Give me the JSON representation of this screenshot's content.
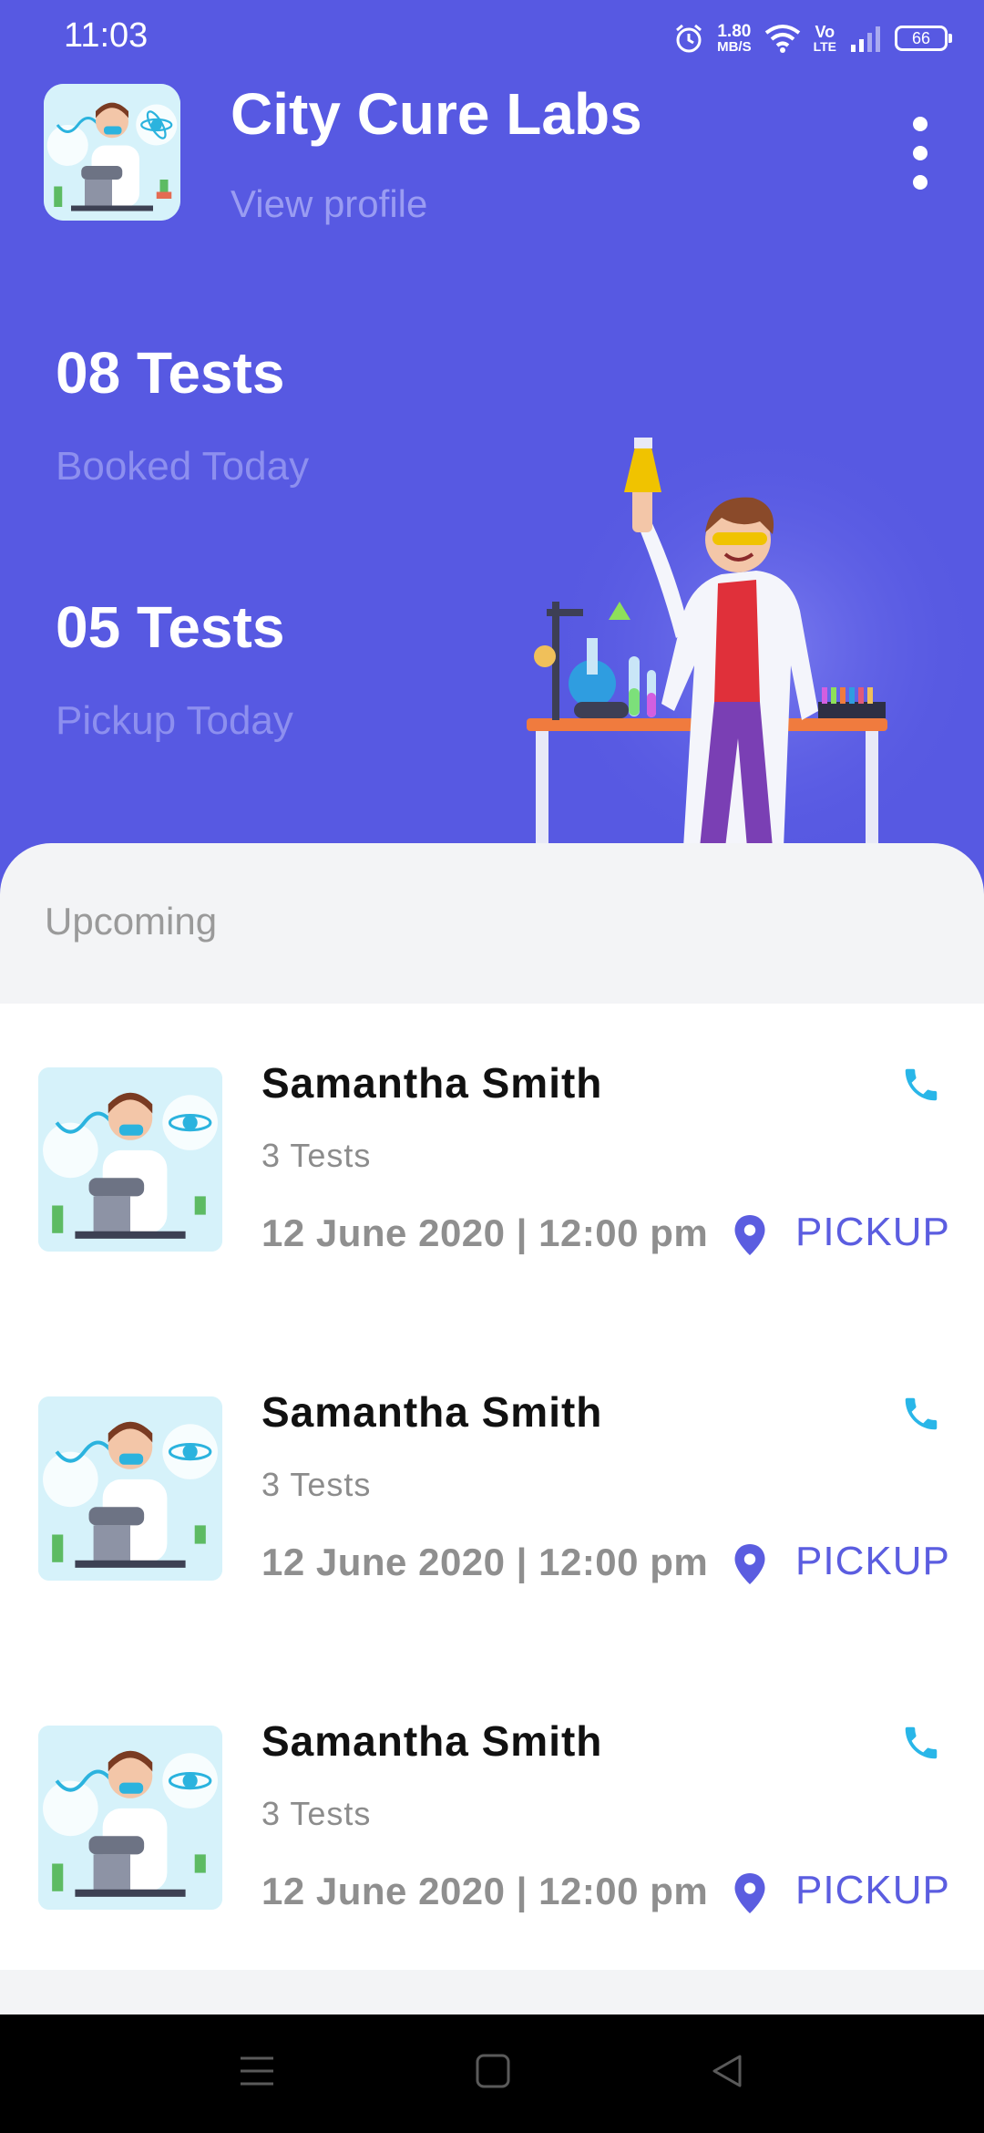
{
  "status_bar": {
    "time": "11:03",
    "net_speed_value": "1.80",
    "net_speed_unit": "MB/S",
    "volte_top": "Vo",
    "volte_bottom": "LTE",
    "battery": "66",
    "icons": [
      "alarm-icon",
      "wifi-icon",
      "signal-icon",
      "battery-icon"
    ]
  },
  "header": {
    "title": "City Cure Labs",
    "view_profile": "View profile",
    "menu_icon": "more-vertical-icon"
  },
  "stats": [
    {
      "value": "08 Tests",
      "label": "Booked Today"
    },
    {
      "value": "05 Tests",
      "label": "Pickup Today"
    }
  ],
  "upcoming": {
    "title": "Upcoming",
    "items": [
      {
        "name": "Samantha Smith",
        "tests": "3 Tests",
        "datetime": "12 June 2020 | 12:00 pm",
        "status": "PICKUP"
      },
      {
        "name": "Samantha Smith",
        "tests": "3 Tests",
        "datetime": "12 June 2020 | 12:00 pm",
        "status": "PICKUP"
      },
      {
        "name": "Samantha Smith",
        "tests": "3 Tests",
        "datetime": "12 June 2020 | 12:00 pm",
        "status": "PICKUP"
      }
    ]
  },
  "colors": {
    "primary": "#5759E2",
    "accent_call": "#29B6E8",
    "pickup": "#5B5DE0",
    "sheet_bg": "#F3F4F6"
  },
  "nav_bar": {
    "icons": [
      "menu-icon",
      "home-icon",
      "back-icon"
    ]
  }
}
